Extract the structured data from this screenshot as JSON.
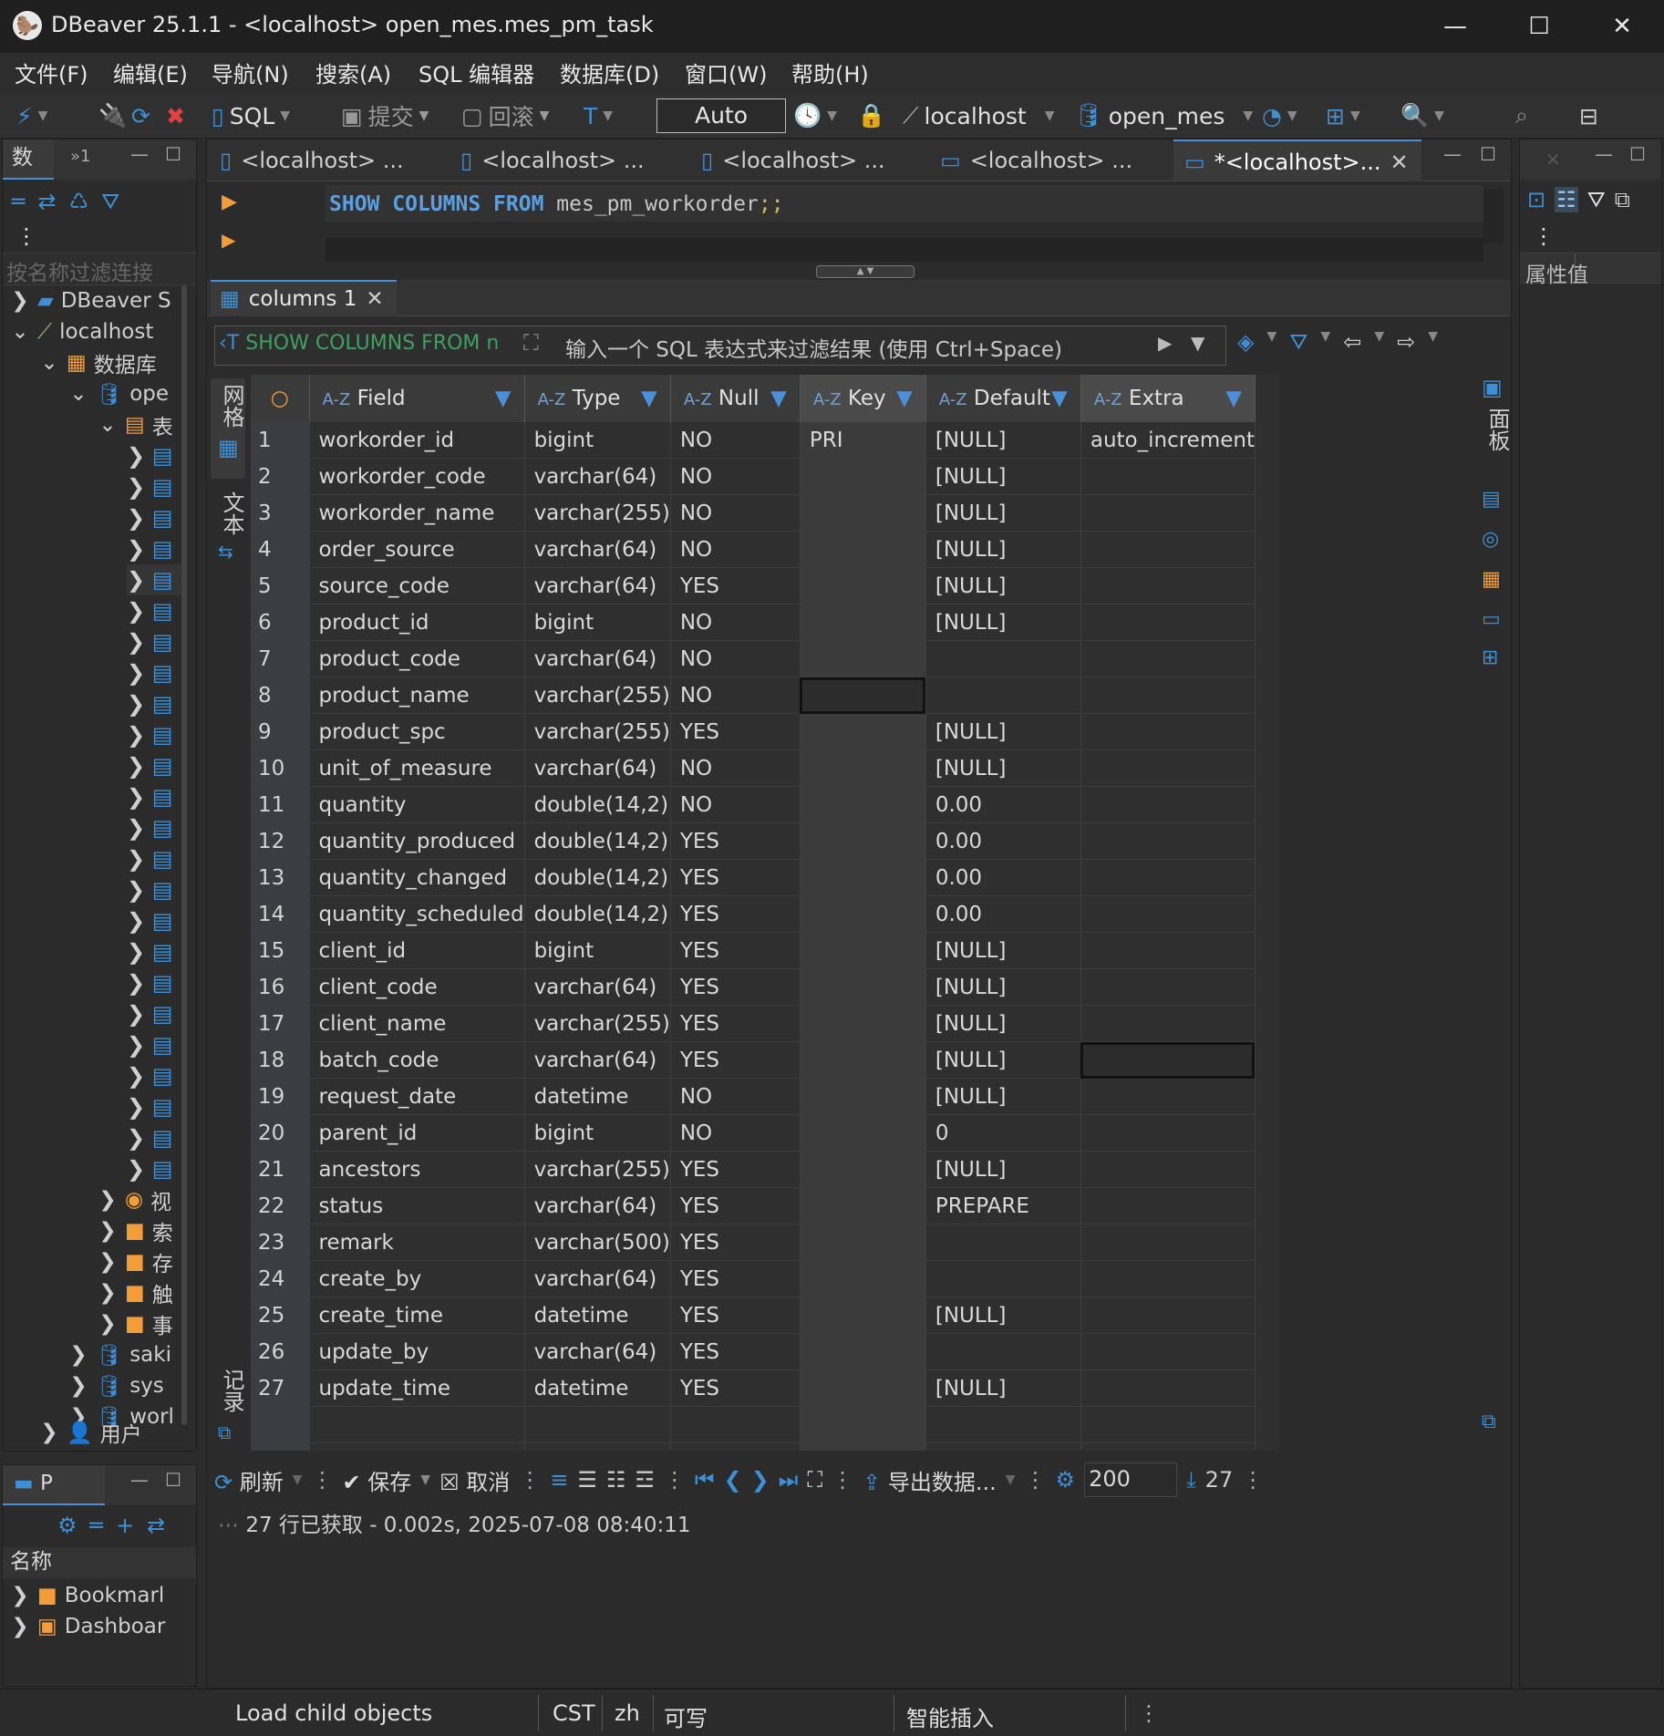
{
  "window": {
    "title": "DBeaver 25.1.1 - <localhost> open_mes.mes_pm_task",
    "minimize": "—",
    "maximize": "☐",
    "close": "✕"
  },
  "menu": [
    "文件(F)",
    "编辑(E)",
    "导航(N)",
    "搜索(A)",
    "SQL 编辑器",
    "数据库(D)",
    "窗口(W)",
    "帮助(H)"
  ],
  "toolbar": {
    "sql": "SQL",
    "commit": "提交",
    "rollback": "回滚",
    "mode": "Auto",
    "connection": "localhost",
    "schema": "open_mes"
  },
  "navigator": {
    "tab_label": "数",
    "tab2_label": "»1",
    "filter_placeholder": "按名称过滤连接",
    "items": [
      {
        "label": "DBeaver S"
      },
      {
        "label": "localhost"
      },
      {
        "label": "数据库"
      },
      {
        "label": "ope"
      },
      {
        "label": "表"
      },
      {
        "label": "视"
      },
      {
        "label": "索"
      },
      {
        "label": "存"
      },
      {
        "label": "触"
      },
      {
        "label": "事"
      },
      {
        "label": "saki"
      },
      {
        "label": "sys"
      },
      {
        "label": "worl"
      },
      {
        "label": "用户"
      }
    ]
  },
  "projects": {
    "tab_label": "P",
    "header": "名称",
    "items": [
      "Bookmarl",
      "Dashboar"
    ]
  },
  "editor_tabs": [
    {
      "label": "<localhost> ..."
    },
    {
      "label": "<localhost> ..."
    },
    {
      "label": "<localhost> ..."
    },
    {
      "label": "<localhost> ..."
    },
    {
      "label": "*<localhost>..."
    }
  ],
  "sql": {
    "kw1": "SHOW",
    "kw2": "COLUMNS",
    "kw3": "FROM",
    "ident": "mes_pm_workorder",
    "punct": ";;"
  },
  "results": {
    "tab_label": "columns 1",
    "query_chip": "SHOW COLUMNS FROM n",
    "filter_placeholder": "输入一个 SQL 表达式来过滤结果 (使用 Ctrl+Space)",
    "side_left_top": "网格",
    "side_left_mid": "文本",
    "side_left_bottom": "记录",
    "side_right": "面板",
    "columns": [
      "Field",
      "Type",
      "Null",
      "Key",
      "Default",
      "Extra"
    ],
    "rows": [
      [
        "1",
        "workorder_id",
        "bigint",
        "NO",
        "PRI",
        "[NULL]",
        "auto_increment"
      ],
      [
        "2",
        "workorder_code",
        "varchar(64)",
        "NO",
        "",
        "[NULL]",
        ""
      ],
      [
        "3",
        "workorder_name",
        "varchar(255)",
        "NO",
        "",
        "[NULL]",
        ""
      ],
      [
        "4",
        "order_source",
        "varchar(64)",
        "NO",
        "",
        "[NULL]",
        ""
      ],
      [
        "5",
        "source_code",
        "varchar(64)",
        "YES",
        "",
        "[NULL]",
        ""
      ],
      [
        "6",
        "product_id",
        "bigint",
        "NO",
        "",
        "[NULL]",
        ""
      ],
      [
        "7",
        "product_code",
        "varchar(64)",
        "NO",
        "",
        "",
        ""
      ],
      [
        "8",
        "product_name",
        "varchar(255)",
        "NO",
        "",
        "",
        ""
      ],
      [
        "9",
        "product_spc",
        "varchar(255)",
        "YES",
        "",
        "[NULL]",
        ""
      ],
      [
        "10",
        "unit_of_measure",
        "varchar(64)",
        "NO",
        "",
        "[NULL]",
        ""
      ],
      [
        "11",
        "quantity",
        "double(14,2)",
        "NO",
        "",
        "0.00",
        ""
      ],
      [
        "12",
        "quantity_produced",
        "double(14,2)",
        "YES",
        "",
        "0.00",
        ""
      ],
      [
        "13",
        "quantity_changed",
        "double(14,2)",
        "YES",
        "",
        "0.00",
        ""
      ],
      [
        "14",
        "quantity_scheduled",
        "double(14,2)",
        "YES",
        "",
        "0.00",
        ""
      ],
      [
        "15",
        "client_id",
        "bigint",
        "YES",
        "",
        "[NULL]",
        ""
      ],
      [
        "16",
        "client_code",
        "varchar(64)",
        "YES",
        "",
        "[NULL]",
        ""
      ],
      [
        "17",
        "client_name",
        "varchar(255)",
        "YES",
        "",
        "[NULL]",
        ""
      ],
      [
        "18",
        "batch_code",
        "varchar(64)",
        "YES",
        "",
        "[NULL]",
        ""
      ],
      [
        "19",
        "request_date",
        "datetime",
        "NO",
        "",
        "[NULL]",
        ""
      ],
      [
        "20",
        "parent_id",
        "bigint",
        "NO",
        "",
        "0",
        ""
      ],
      [
        "21",
        "ancestors",
        "varchar(255)",
        "YES",
        "",
        "[NULL]",
        ""
      ],
      [
        "22",
        "status",
        "varchar(64)",
        "YES",
        "",
        "PREPARE",
        ""
      ],
      [
        "23",
        "remark",
        "varchar(500)",
        "YES",
        "",
        "",
        ""
      ],
      [
        "24",
        "create_by",
        "varchar(64)",
        "YES",
        "",
        "",
        ""
      ],
      [
        "25",
        "create_time",
        "datetime",
        "YES",
        "",
        "[NULL]",
        ""
      ],
      [
        "26",
        "update_by",
        "varchar(64)",
        "YES",
        "",
        "",
        ""
      ],
      [
        "27",
        "update_time",
        "datetime",
        "YES",
        "",
        "[NULL]",
        ""
      ]
    ],
    "bottom": {
      "refresh": "刷新",
      "save": "保存",
      "cancel": "取消",
      "export": "导出数据...",
      "fetch_size": "200",
      "row_count": "27"
    },
    "status_line": "27 行已获取 - 0.002s, 2025-07-08 08:40:11"
  },
  "properties": {
    "header1": "属性",
    "header2": "值"
  },
  "statusbar": {
    "task": "Load child objects",
    "tz": "CST",
    "locale": "zh",
    "mode": "可写",
    "insert": "智能插入"
  }
}
